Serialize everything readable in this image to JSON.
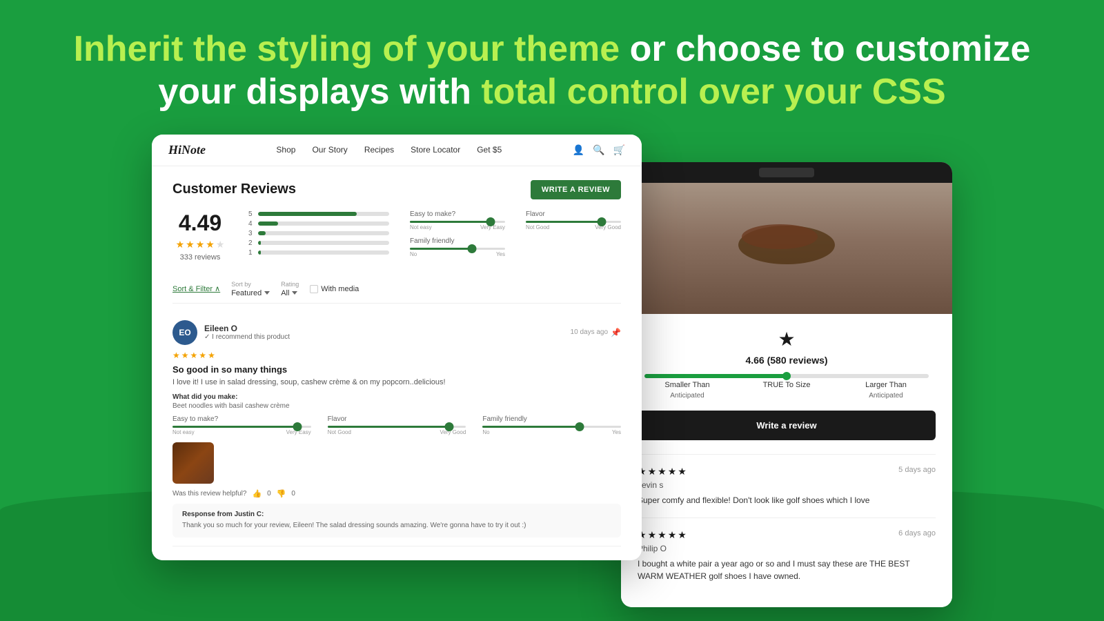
{
  "hero": {
    "line1_white": "Inherit the styling of your theme",
    "line1_connector": " or choose to customize",
    "line2_white_pre": "your displays with ",
    "line2_green": "total control over your CSS"
  },
  "left_screenshot": {
    "nav": {
      "logo": "HiNote",
      "links": [
        "Shop",
        "Our Story",
        "Recipes",
        "Store Locator",
        "Get $5"
      ]
    },
    "reviews": {
      "title": "Customer Reviews",
      "write_btn": "WRITE A REVIEW",
      "rating": "4.49",
      "reviews_count": "333 reviews",
      "bars": [
        {
          "label": "5",
          "fill": 75
        },
        {
          "label": "4",
          "fill": 15
        },
        {
          "label": "3",
          "fill": 6
        },
        {
          "label": "2",
          "fill": 2
        },
        {
          "label": "1",
          "fill": 2
        }
      ],
      "sliders": [
        {
          "name": "Easy to make?",
          "left": "Not easy",
          "right": "Very Easy",
          "value": 85
        },
        {
          "name": "Flavor",
          "left": "Not Good",
          "right": "Very Good",
          "value": 80
        },
        {
          "name": "Family friendly",
          "left": "No",
          "right": "Yes",
          "value": 65
        }
      ],
      "sort_filter_label": "Sort & Filter ∧",
      "sort_by_label": "Sort by",
      "sort_by_value": "Featured",
      "rating_label": "Rating",
      "rating_value": "All",
      "with_media": "With media",
      "review_item": {
        "initials": "EO",
        "name": "Eileen O",
        "recommend": "✓ I recommend this product",
        "date": "10 days ago",
        "title": "So good in so many things",
        "body": "I love it! I use in salad dressing, soup, cashew crème & on my popcorn..delicious!",
        "made_label": "What did you make:",
        "made_value": "Beet noodles with basil cashew crème",
        "helpful_text": "Was this review helpful?",
        "helpful_yes": "0",
        "helpful_no": "0",
        "review_sliders": [
          {
            "name": "Easy to make?",
            "left": "Not easy",
            "right": "Very Easy",
            "value": 90
          },
          {
            "name": "Flavor",
            "left": "Not Good",
            "right": "Very Good",
            "value": 88
          },
          {
            "name": "Family friendly",
            "left": "No",
            "right": "Yes",
            "value": 70
          }
        ],
        "response": {
          "from": "Response from Justin C:",
          "text": "Thank you so much for your review, Eileen! The salad dressing sounds amazing. We're gonna have to try it out :)"
        }
      }
    }
  },
  "right_screenshot": {
    "rating_star": "★",
    "rating_text": "4.66 (580 reviews)",
    "size_items": [
      {
        "label": "Smaller Than\nAnticipated",
        "position": 20
      },
      {
        "label": "TRUE To Size",
        "position": 50
      },
      {
        "label": "Larger Than\nAnticipated",
        "position": 80
      }
    ],
    "write_btn": "Write a review",
    "reviews": [
      {
        "stars": 5,
        "date": "5 days ago",
        "name": "kevin s",
        "body": "Super comfy and flexible! Don't look like golf shoes which I love"
      },
      {
        "stars": 5,
        "date": "6 days ago",
        "name": "Philip O",
        "body": "I bought a white pair a year ago or so and I must say these are THE BEST WARM WEATHER golf shoes I have owned."
      }
    ]
  }
}
